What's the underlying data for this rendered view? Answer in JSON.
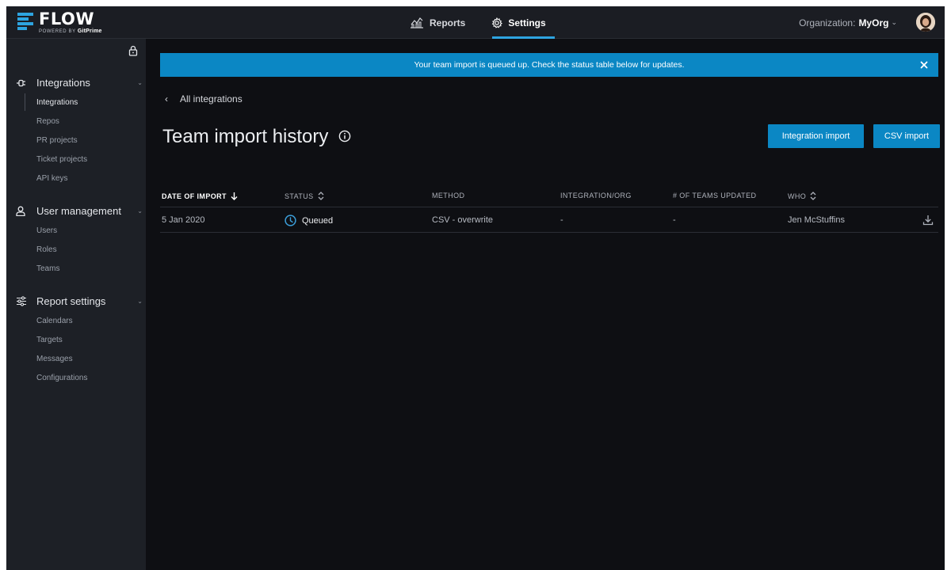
{
  "app": {
    "logo_word": "FLOW",
    "logo_powered": "POWERED BY",
    "logo_brand": "GitPrime"
  },
  "nav": {
    "reports": "Reports",
    "settings": "Settings",
    "active": "Settings"
  },
  "org": {
    "prefix": "Organization:",
    "name": "MyOrg"
  },
  "sidebar": {
    "sections": [
      {
        "title": "Integrations",
        "icon": "plug-icon",
        "items": [
          "Integrations",
          "Repos",
          "PR projects",
          "Ticket projects",
          "API keys"
        ],
        "active_item": "Integrations"
      },
      {
        "title": "User management",
        "icon": "user-icon",
        "items": [
          "Users",
          "Roles",
          "Teams"
        ]
      },
      {
        "title": "Report settings",
        "icon": "sliders-icon",
        "items": [
          "Calendars",
          "Targets",
          "Messages",
          "Configurations"
        ]
      }
    ]
  },
  "banner": {
    "text": "Your team import is queued up. Check the status table below for updates."
  },
  "page": {
    "back_label": "All integrations",
    "title": "Team import history",
    "buttons": {
      "integration_import": "Integration import",
      "csv_import": "CSV import"
    }
  },
  "table": {
    "headers": [
      "DATE OF IMPORT",
      "STATUS",
      "METHOD",
      "INTEGRATION/ORG",
      "# OF TEAMS UPDATED",
      "WHO"
    ],
    "rows": [
      {
        "date": "5 Jan 2020",
        "status": "Queued",
        "method": "CSV - overwrite",
        "integration": "-",
        "teams_updated": "-",
        "who": "Jen McStuffins"
      }
    ]
  },
  "colors": {
    "accent": "#0b87c4",
    "nav_underline": "#2ea4e0",
    "status_queued": "#3ca0dc"
  }
}
